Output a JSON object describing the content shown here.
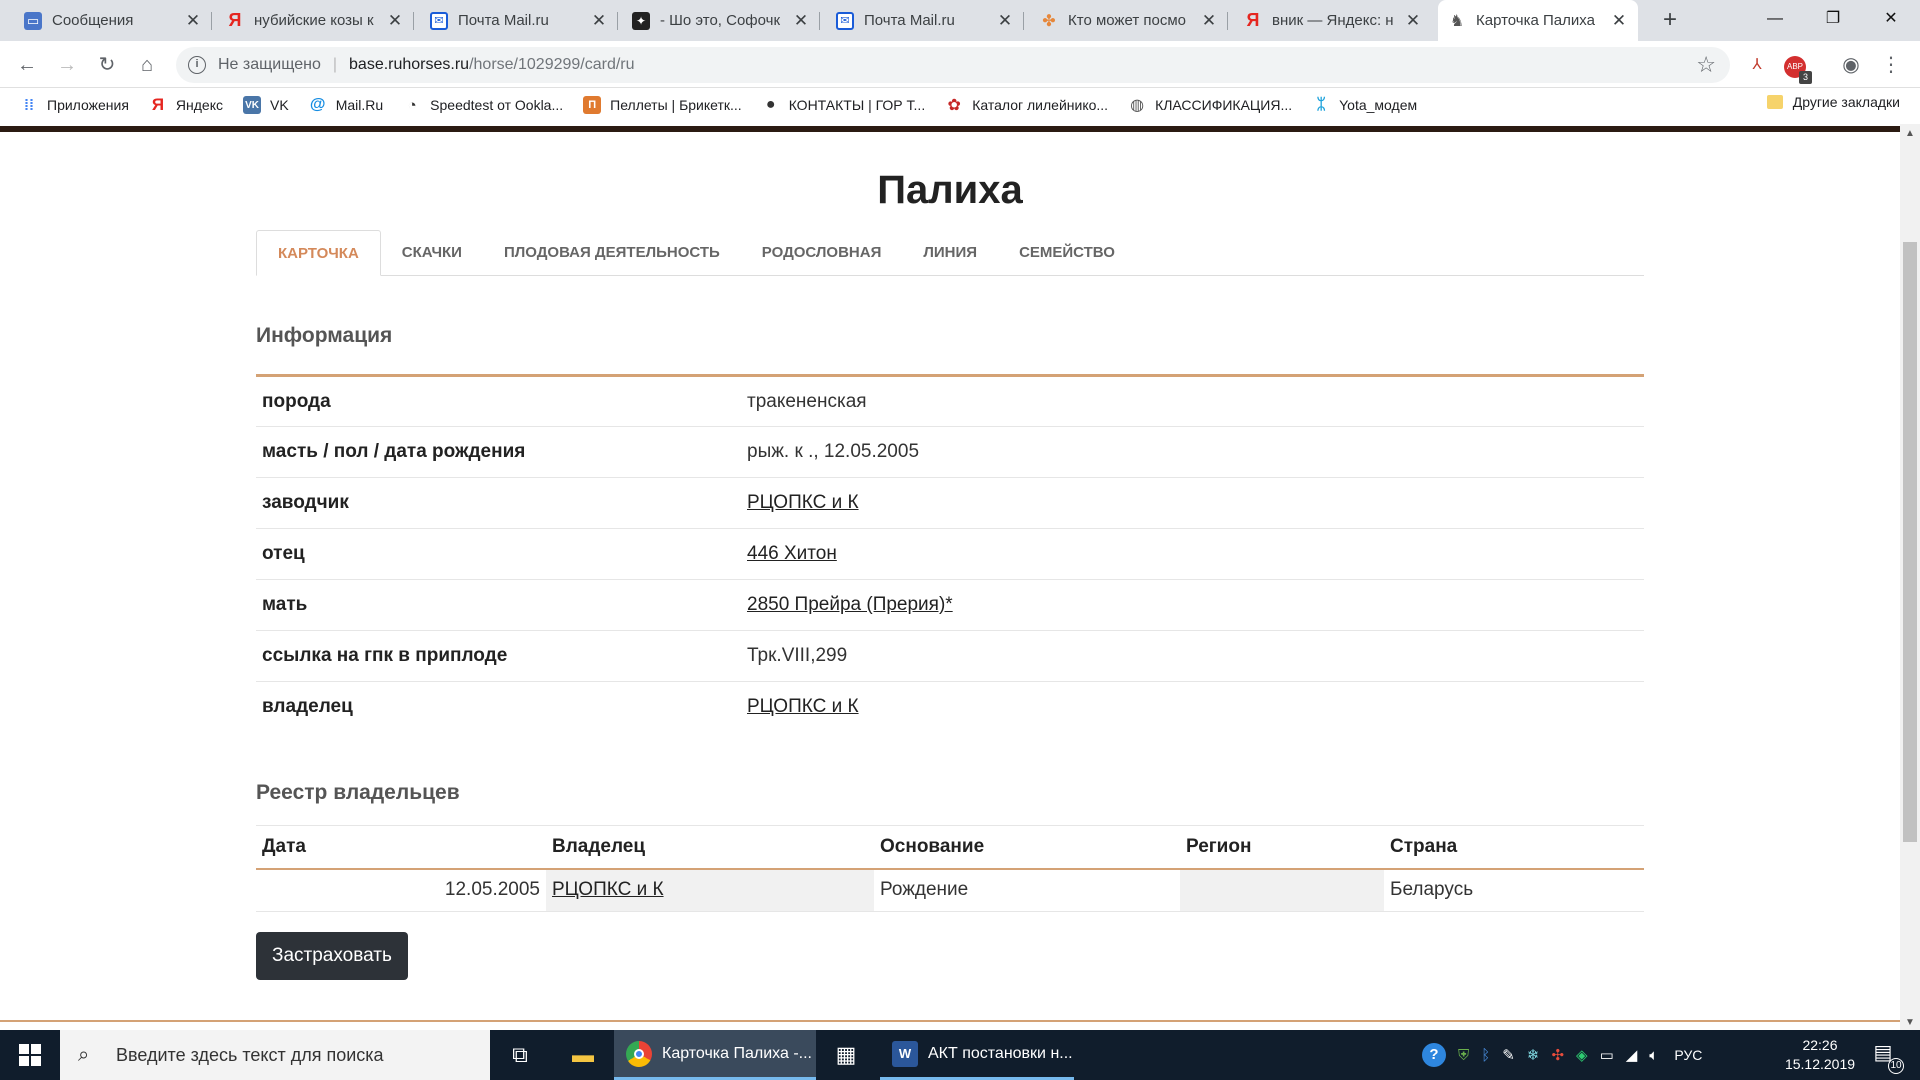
{
  "browser": {
    "tabs": [
      {
        "title": "Сообщения",
        "icon": "messages-icon",
        "active": false
      },
      {
        "title": "нубийские козы к",
        "icon": "yandex-icon",
        "active": false
      },
      {
        "title": "Почта Mail.ru",
        "icon": "mail-icon",
        "active": false
      },
      {
        "title": "- Шо это, Софочк",
        "icon": "dark-app-icon",
        "active": false
      },
      {
        "title": "Почта Mail.ru",
        "icon": "mail-icon",
        "active": false
      },
      {
        "title": "Кто может посмо",
        "icon": "orange-icon",
        "active": false
      },
      {
        "title": "вник — Яндекс: н",
        "icon": "yandex-icon",
        "active": false
      },
      {
        "title": "Карточка Палиха",
        "icon": "horse-icon",
        "active": true
      }
    ],
    "new_tab": "+",
    "address": {
      "security_label": "Не защищено",
      "host": "base.ruhorses.ru",
      "path": "/horse/1029299/card/ru"
    },
    "bookmarks": [
      {
        "label": "Приложения",
        "icon": "apps-grid-icon"
      },
      {
        "label": "Яндекс",
        "icon": "yandex-icon"
      },
      {
        "label": "VK",
        "icon": "vk-icon"
      },
      {
        "label": "Mail.Ru",
        "icon": "mailru-icon"
      },
      {
        "label": "Speedtest от Ookla...",
        "icon": "speedtest-icon"
      },
      {
        "label": "Пеллеты | Брикетк...",
        "icon": "pellets-icon"
      },
      {
        "label": "КОНТАКТЫ | ГОР Т...",
        "icon": "contacts-icon"
      },
      {
        "label": "Каталог лилейнико...",
        "icon": "catalog-icon"
      },
      {
        "label": "КЛАССИФИКАЦИЯ...",
        "icon": "globe-icon"
      },
      {
        "label": "Yota_модем",
        "icon": "yota-icon"
      }
    ],
    "other_bookmarks": "Другие закладки",
    "extension_badge": "3"
  },
  "page": {
    "title": "Палиха",
    "tabs": [
      "КАРТОЧКА",
      "СКАЧКИ",
      "ПЛОДОВАЯ ДЕЯТЕЛЬНОСТЬ",
      "РОДОСЛОВНАЯ",
      "ЛИНИЯ",
      "СЕМЕЙСТВО"
    ],
    "info_heading": "Информация",
    "info": [
      {
        "key": "порода",
        "value": "тракененская",
        "link": false
      },
      {
        "key": "масть / пол / дата рождения",
        "value": "рыж. к ., 12.05.2005",
        "link": false
      },
      {
        "key": "заводчик",
        "value": "РЦОПКС и К",
        "link": true
      },
      {
        "key": "отец",
        "value": "446 Хитон",
        "link": true
      },
      {
        "key": "мать",
        "value": "2850 Прейра (Прерия)*",
        "link": true
      },
      {
        "key": "ссылка на гпк в приплоде",
        "value": "Трк.VIII,299",
        "link": false
      },
      {
        "key": "владелец",
        "value": "РЦОПКС и К",
        "link": true
      }
    ],
    "registry_heading": "Реестр владельцев",
    "registry_headers": [
      "Дата",
      "Владелец",
      "Основание",
      "Регион",
      "Страна"
    ],
    "registry_rows": [
      {
        "date": "12.05.2005",
        "owner": "РЦОПКС и К",
        "basis": "Рождение",
        "region": "",
        "country": "Беларусь"
      }
    ],
    "insure_button": "Застраховать"
  },
  "taskbar": {
    "search_placeholder": "Введите здесь текст для поиска",
    "apps": [
      {
        "label": "Карточка Палиха -...",
        "icon": "chrome-icon"
      },
      {
        "label": "АКТ постановки н...",
        "icon": "word-icon"
      }
    ],
    "language": "РУС",
    "time": "22:26",
    "date": "15.12.2019",
    "notifications": "10"
  }
}
